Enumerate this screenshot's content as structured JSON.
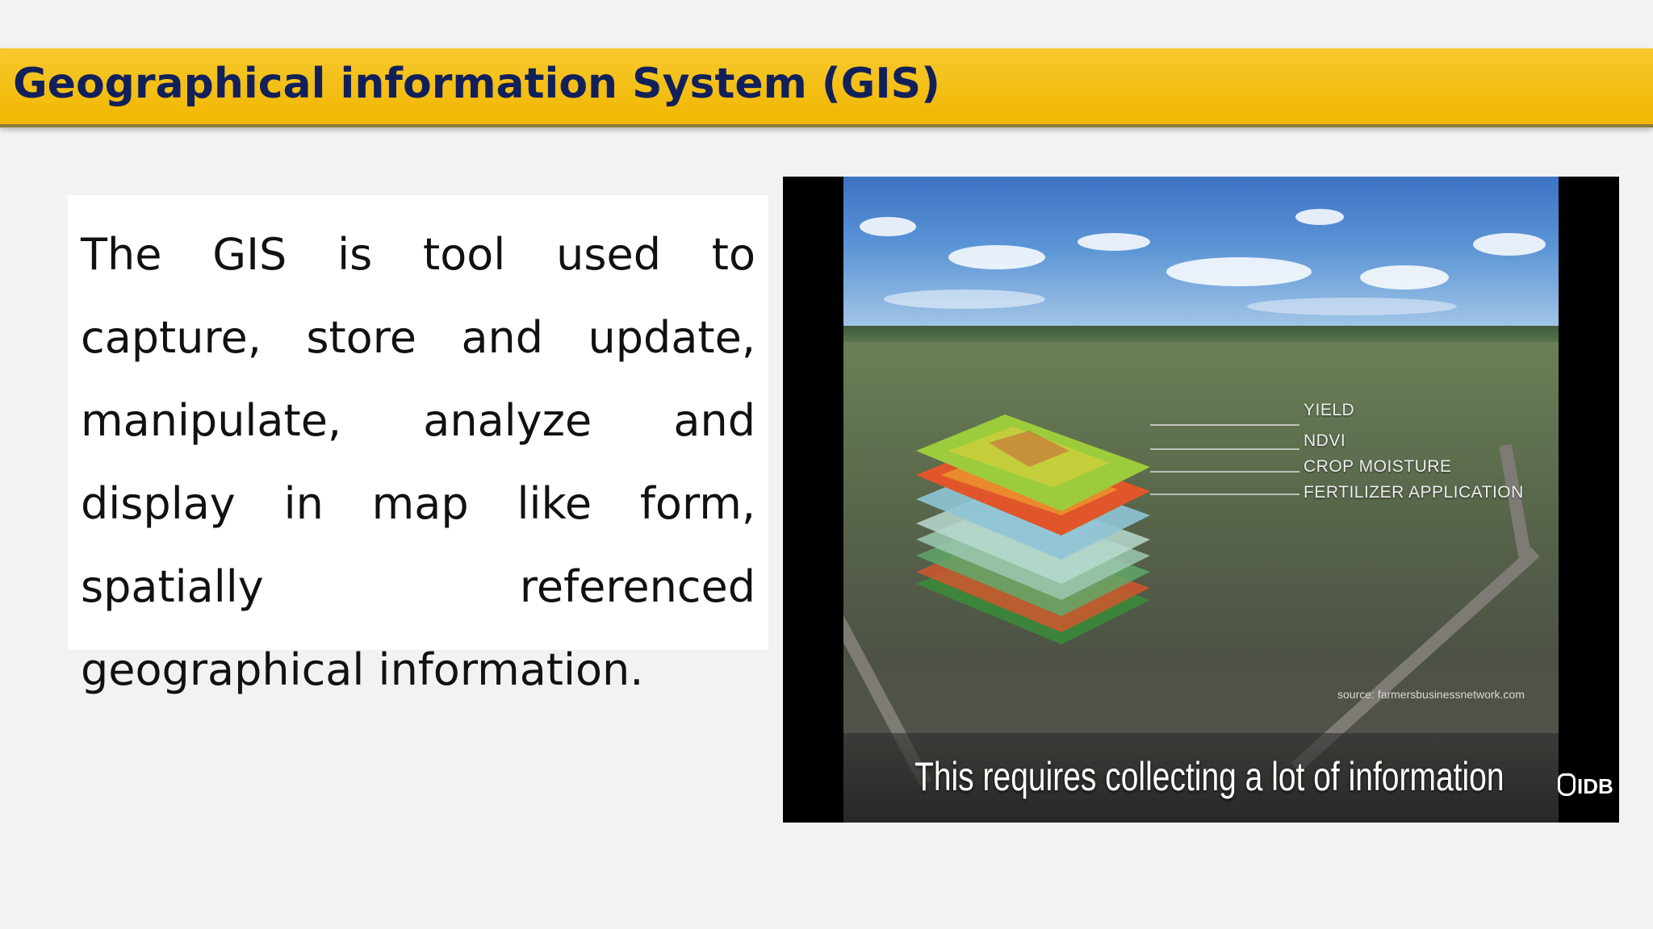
{
  "slide": {
    "title": "Geographical information System (GIS)",
    "body": "The GIS is tool used to capture, store and update, manipulate, analyze and display in map like form, spatially referenced geographical information."
  },
  "video": {
    "layer_labels": [
      "YIELD",
      "NDVI",
      "CROP MOISTURE",
      "FERTILIZER APPLICATION"
    ],
    "source": "source: farmersbusinessnetwork.com",
    "caption": "This requires collecting a lot of information",
    "logo": "IDB"
  },
  "colors": {
    "title_bar": "#f2b600",
    "title_text": "#12205a",
    "background": "#f2f2f2"
  }
}
